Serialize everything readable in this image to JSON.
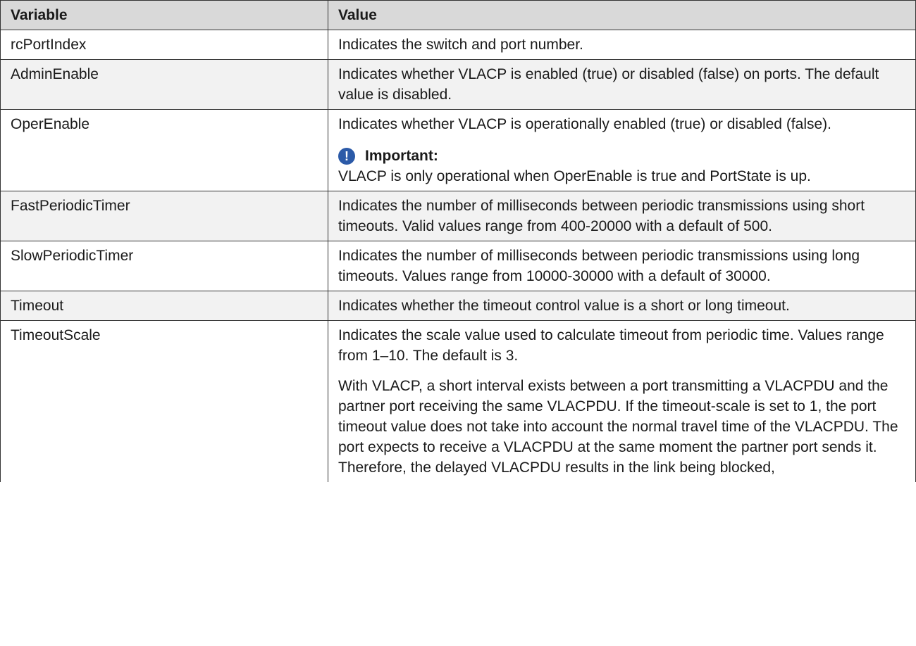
{
  "table": {
    "headers": {
      "variable": "Variable",
      "value": "Value"
    },
    "rows": [
      {
        "variable": "rcPortIndex",
        "value": "Indicates the switch and port number."
      },
      {
        "variable": "AdminEnable",
        "value": "Indicates whether VLACP is enabled (true) or disabled (false) on ports. The default value is disabled."
      },
      {
        "variable": "OperEnable",
        "value": "Indicates whether VLACP is operationally enabled (true) or disabled (false).",
        "note_title": "Important:",
        "note_body": "VLACP is only operational when OperEnable is true and PortState is up.",
        "note_icon": "important-icon"
      },
      {
        "variable": "FastPeriodicTimer",
        "value": "Indicates the number of milliseconds between periodic transmissions using short timeouts. Valid values range from 400-20000 with a default of 500."
      },
      {
        "variable": "SlowPeriodicTimer",
        "value": "Indicates the number of milliseconds between periodic transmissions using long timeouts. Values range from 10000-30000 with a default of 30000."
      },
      {
        "variable": "Timeout",
        "value": "Indicates whether the timeout control value is a short or long timeout."
      },
      {
        "variable": "TimeoutScale",
        "value": "Indicates the scale value used to calculate timeout from periodic time. Values range from 1–10. The default is 3.",
        "value_2": "With VLACP, a short interval exists between a port transmitting a VLACPDU and the partner port receiving the same VLACPDU. If the timeout-scale is set to 1, the port timeout value does not take into account the normal travel time of the VLACPDU. The port expects to receive a VLACPDU at the same moment the partner port sends it. Therefore, the delayed VLACPDU results in the link being blocked,"
      }
    ]
  },
  "colors": {
    "header_bg": "#d9d9d9",
    "shaded_row_bg": "#f2f2f2",
    "important_icon": "#2b5aa8",
    "border": "#333333"
  }
}
